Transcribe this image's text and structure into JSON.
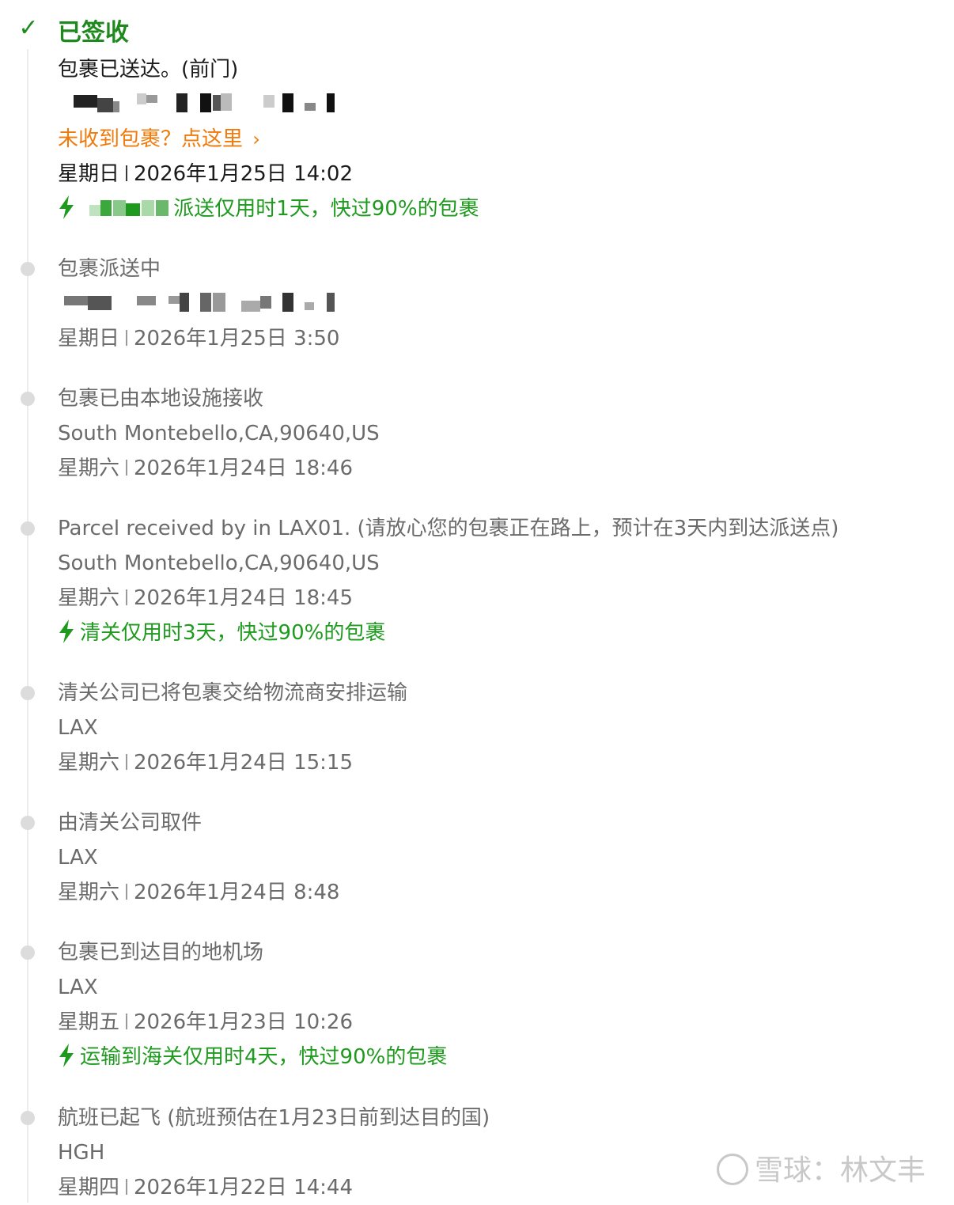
{
  "events": [
    {
      "status": "已签收",
      "detail": "包裹已送达。(前门)",
      "link": "未收到包裹？点这里",
      "weekday": "星期日",
      "datetime": "2026年1月25日 14:02",
      "note": "派送仅用时1天，快过90%的包裹"
    },
    {
      "status": "包裹派送中",
      "weekday": "星期日",
      "datetime": "2026年1月25日 3:50"
    },
    {
      "status": "包裹已由本地设施接收",
      "location": "South Montebello,CA,90640,US",
      "weekday": "星期六",
      "datetime": "2026年1月24日 18:46"
    },
    {
      "status": "Parcel received by in LAX01. (请放心您的包裹正在路上，预计在3天内到达派送点)",
      "location": "South Montebello,CA,90640,US",
      "weekday": "星期六",
      "datetime": "2026年1月24日 18:45",
      "note": "清关仅用时3天，快过90%的包裹"
    },
    {
      "status": "清关公司已将包裹交给物流商安排运输",
      "location": "LAX",
      "weekday": "星期六",
      "datetime": "2026年1月24日 15:15"
    },
    {
      "status": "由清关公司取件",
      "location": "LAX",
      "weekday": "星期六",
      "datetime": "2026年1月24日 8:48"
    },
    {
      "status": "包裹已到达目的地机场",
      "location": "LAX",
      "weekday": "星期五",
      "datetime": "2026年1月23日 10:26",
      "note": "运输到海关仅用时4天，快过90%的包裹"
    },
    {
      "status": "航班已起飞 (航班预估在1月23日前到达目的国)",
      "location": "HGH",
      "weekday": "星期四",
      "datetime": "2026年1月22日 14:44"
    }
  ],
  "watermark": "雪球：林文丰",
  "colors": {
    "delivered_green": "#1e8a1e",
    "note_green": "#1e9a1e",
    "link_orange": "#f07a0a",
    "muted_gray": "#6b6b6b",
    "dot_gray": "#dcdcdc"
  },
  "icons": [
    "check-icon",
    "bolt-icon",
    "chevron-right-icon"
  ]
}
